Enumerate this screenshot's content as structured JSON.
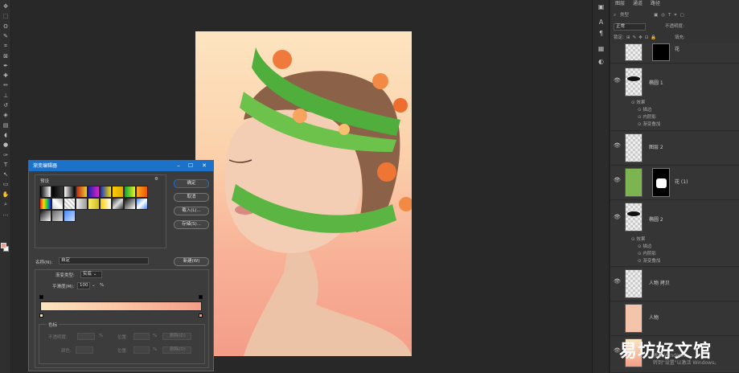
{
  "toolbar": {
    "tools": [
      "move-icon",
      "marquee-icon",
      "lasso-icon",
      "quick-select-icon",
      "crop-icon",
      "frame-icon",
      "eyedropper-icon",
      "healing-icon",
      "brush-icon",
      "clone-stamp-icon",
      "history-brush-icon",
      "eraser-icon",
      "gradient-icon",
      "blur-icon",
      "dodge-icon",
      "pen-icon",
      "type-icon",
      "path-select-icon",
      "shape-icon",
      "hand-icon",
      "zoom-icon",
      "more-icon"
    ],
    "glyphs": [
      "✥",
      "⬚",
      "ʘ",
      "✎",
      "⌗",
      "⊠",
      "✒",
      "✚",
      "✏",
      "⊥",
      "↺",
      "◈",
      "▤",
      "◖",
      "●",
      "✑",
      "T",
      "↖",
      "▭",
      "✋",
      "⌕",
      "…"
    ]
  },
  "colors": {
    "foreground": "#f0a090",
    "background": "#ffffff",
    "accent": "#1b72c8"
  },
  "layers_panel": {
    "tabs": [
      "图层",
      "通道",
      "路径"
    ],
    "kind_filter": "类型",
    "blend_mode": "正常",
    "opacity_label": "不透明度:",
    "lock_label": "锁定:",
    "fill_label": "填充:",
    "layers": [
      {
        "name": "花",
        "has_mask": true,
        "partial": true
      },
      {
        "name": "椭圆 1",
        "effects_label": "效果",
        "effects": [
          "描边",
          "内阴影",
          "渐变叠加"
        ]
      },
      {
        "name": "图层 2"
      },
      {
        "name": "花 (1)",
        "has_mask": true
      },
      {
        "name": "椭圆 2",
        "effects_label": "效果",
        "effects": [
          "描边",
          "内阴影",
          "渐变叠加"
        ]
      },
      {
        "name": "人物 拷贝"
      },
      {
        "name": "人物"
      }
    ]
  },
  "dialog": {
    "title": "渐变编辑器",
    "presets_label": "预设",
    "buttons": {
      "ok": "确定",
      "cancel": "取消",
      "load": "载入(L)...",
      "save": "存储(S)...",
      "new": "新建(W)"
    },
    "name_label": "名称(N):",
    "name_value": "自定",
    "gradient_type_label": "渐变类型:",
    "gradient_type_value": "实底",
    "smoothness_label": "平滑度(M):",
    "smoothness_value": "100",
    "smoothness_unit": "%",
    "color_stops_label": "色标",
    "opacity_label": "不透明度:",
    "color_label": "颜色:",
    "location_label": "位置:",
    "percent": "%",
    "delete_label": "删除(D)",
    "gradient_start": "#fde4c0",
    "gradient_end": "#f49d88"
  },
  "watermark": {
    "text": "易坊好文馆",
    "activate_line1": "激活 Windows",
    "activate_line2": "转到\"设置\"以激活 Windows。"
  }
}
